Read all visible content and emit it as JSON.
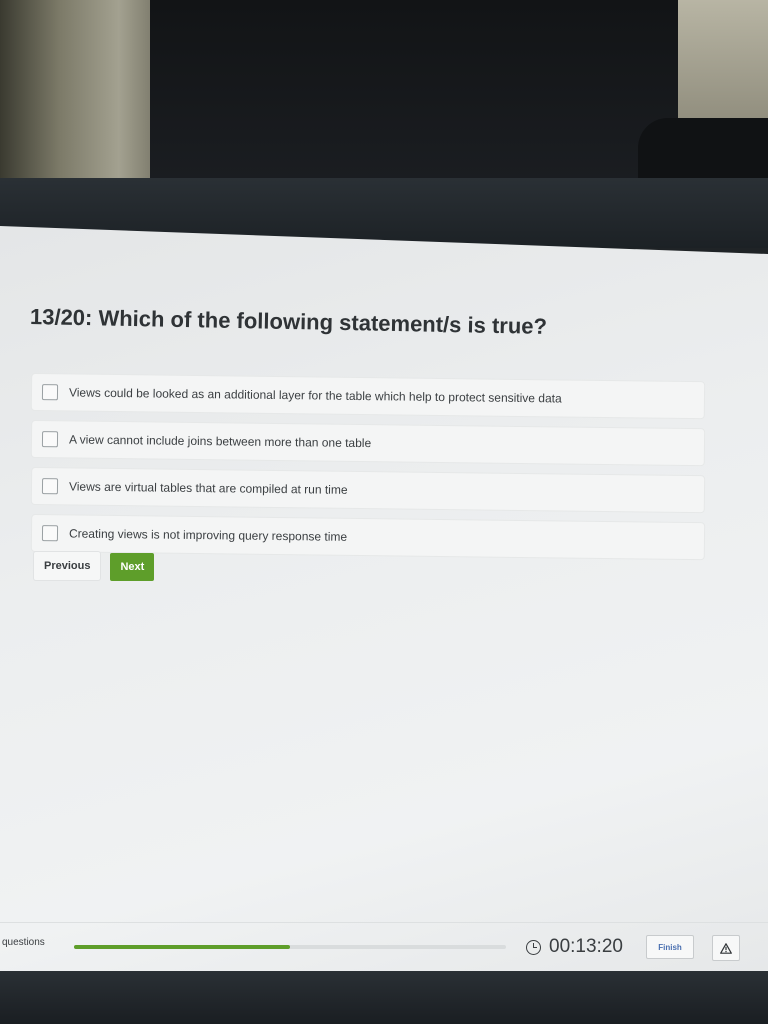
{
  "question": {
    "number": "13/20",
    "title": "13/20: Which of the following statement/s is true?"
  },
  "options": [
    {
      "label": "Views could be looked as an additional layer for the table which help to protect sensitive data",
      "checked": false
    },
    {
      "label": "A view cannot include joins between more than one table",
      "checked": false
    },
    {
      "label": "Views are virtual tables that are compiled at run time",
      "checked": false
    },
    {
      "label": "Creating views is not improving query response time",
      "checked": false
    }
  ],
  "nav": {
    "previous_label": "Previous",
    "next_label": "Next"
  },
  "footer": {
    "questions_label": "questions",
    "progress_fraction": 0.5,
    "timer": "00:13:20",
    "finish_label": "Finish"
  },
  "icons": {
    "timer": "clock-icon",
    "report": "warning-icon",
    "checkbox": "checkbox-icon"
  },
  "colors": {
    "accent_green": "#5e9e2a",
    "finish_text": "#4a6fb0"
  }
}
